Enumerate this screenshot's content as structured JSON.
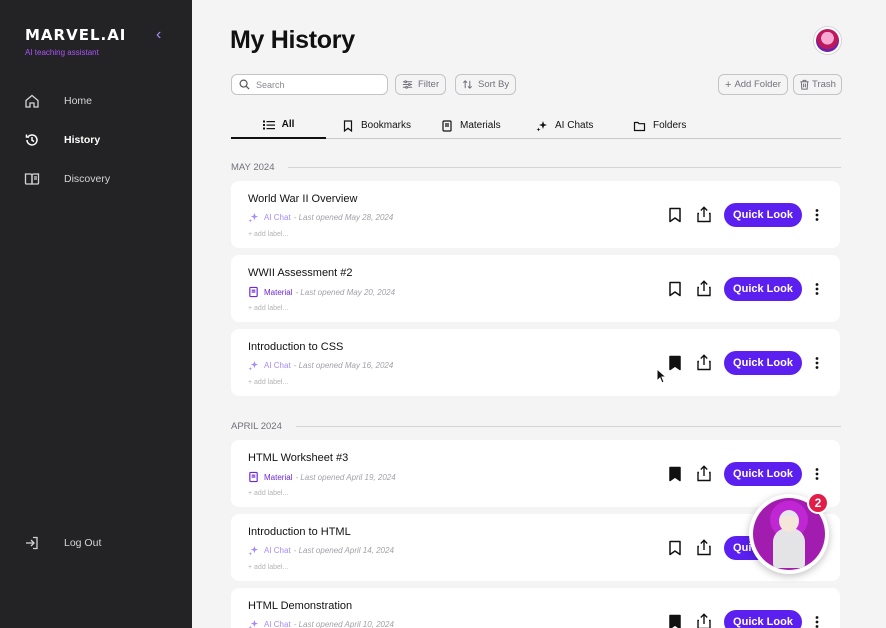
{
  "sidebar": {
    "brand": "MARVEL.AI",
    "tagline": "AI teaching assistant",
    "nav": [
      {
        "label": "Home",
        "icon": "home-icon"
      },
      {
        "label": "History",
        "icon": "history-icon"
      },
      {
        "label": "Discovery",
        "icon": "book-icon"
      }
    ],
    "logout": "Log Out"
  },
  "header": {
    "title": "My History"
  },
  "toolbar": {
    "search_placeholder": "Search",
    "filter": "Filter",
    "sort": "Sort By",
    "add_folder": "Add Folder",
    "trash": "Trash"
  },
  "tabs": [
    "All",
    "Bookmarks",
    "Materials",
    "AI Chats",
    "Folders"
  ],
  "sections": [
    "MAY 2024",
    "APRIL 2024"
  ],
  "items": [
    {
      "title": "World War II Overview",
      "type": "AI Chat",
      "opened": "- Last opened May 28, 2024",
      "label": "+ add label...",
      "bookmarked": false
    },
    {
      "title": "WWII Assessment #2",
      "type": "Material",
      "opened": "- Last opened May 20, 2024",
      "label": "+ add label...",
      "bookmarked": false
    },
    {
      "title": "Introduction to CSS",
      "type": "AI Chat",
      "opened": "- Last opened May 16, 2024",
      "label": "+ add label...",
      "bookmarked": true
    },
    {
      "title": "HTML Worksheet #3",
      "type": "Material",
      "opened": "- Last opened April 19, 2024",
      "label": "+ add label...",
      "bookmarked": true
    },
    {
      "title": "Introduction to HTML",
      "type": "AI Chat",
      "opened": "- Last opened April 14, 2024",
      "label": "+ add label...",
      "bookmarked": false
    },
    {
      "title": "HTML Demonstration",
      "type": "AI Chat",
      "opened": "- Last opened April 10, 2024",
      "label": "",
      "bookmarked": true
    }
  ],
  "quick_look": "Quick Look",
  "assistant": {
    "badge": "2"
  },
  "colors": {
    "accent": "#5b1ff0",
    "sidebar": "#232325",
    "badge": "#e11d48"
  }
}
